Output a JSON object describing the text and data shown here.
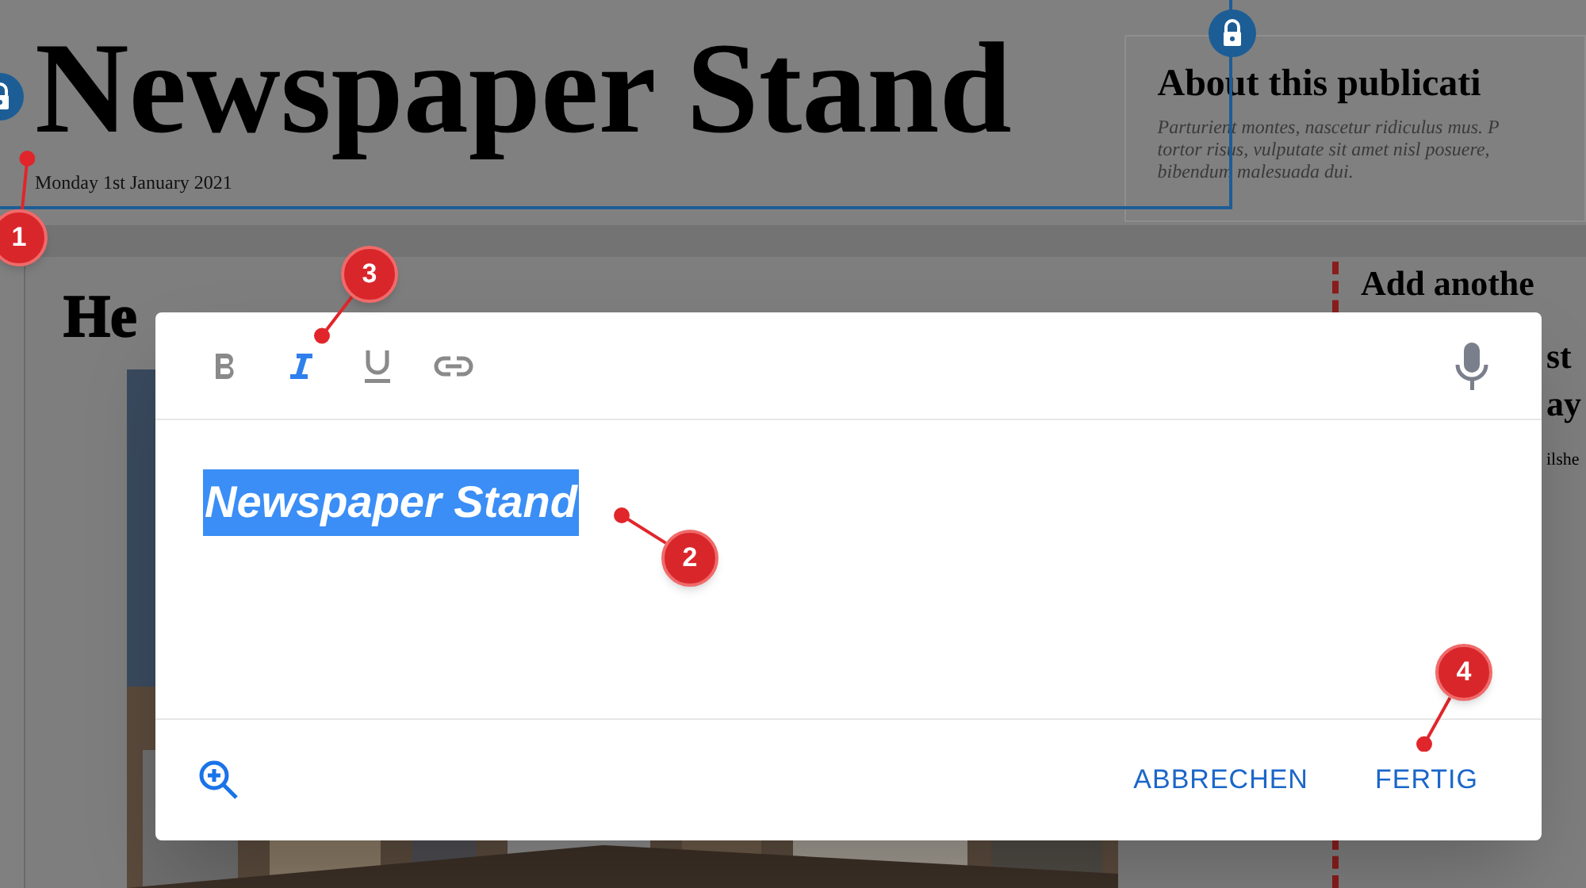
{
  "page": {
    "title": "Newspaper Stand",
    "date": "Monday 1st January 2021",
    "about": {
      "heading": "About this publicati",
      "lines": [
        "Parturient montes, nascetur ridiculus mus. P",
        "tortor risus, vulputate sit amet nisl posuere,",
        "bibendum malesuada dui."
      ]
    },
    "headline": "He",
    "side": {
      "heading": "Add anothe",
      "fragments": [
        "st",
        "ay",
        "ilshe"
      ]
    }
  },
  "editor": {
    "toolbar": [
      {
        "kind": "bold",
        "selected": false
      },
      {
        "kind": "italic",
        "selected": true
      },
      {
        "kind": "underline",
        "selected": false
      },
      {
        "kind": "link",
        "selected": false
      }
    ],
    "text": "Newspaper Stand",
    "text_selected": true,
    "actions": [
      "ABBRECHEN",
      "FERTIG"
    ]
  },
  "annotations": [
    {
      "label": "1"
    },
    {
      "label": "2"
    },
    {
      "label": "3"
    },
    {
      "label": "4"
    }
  ]
}
